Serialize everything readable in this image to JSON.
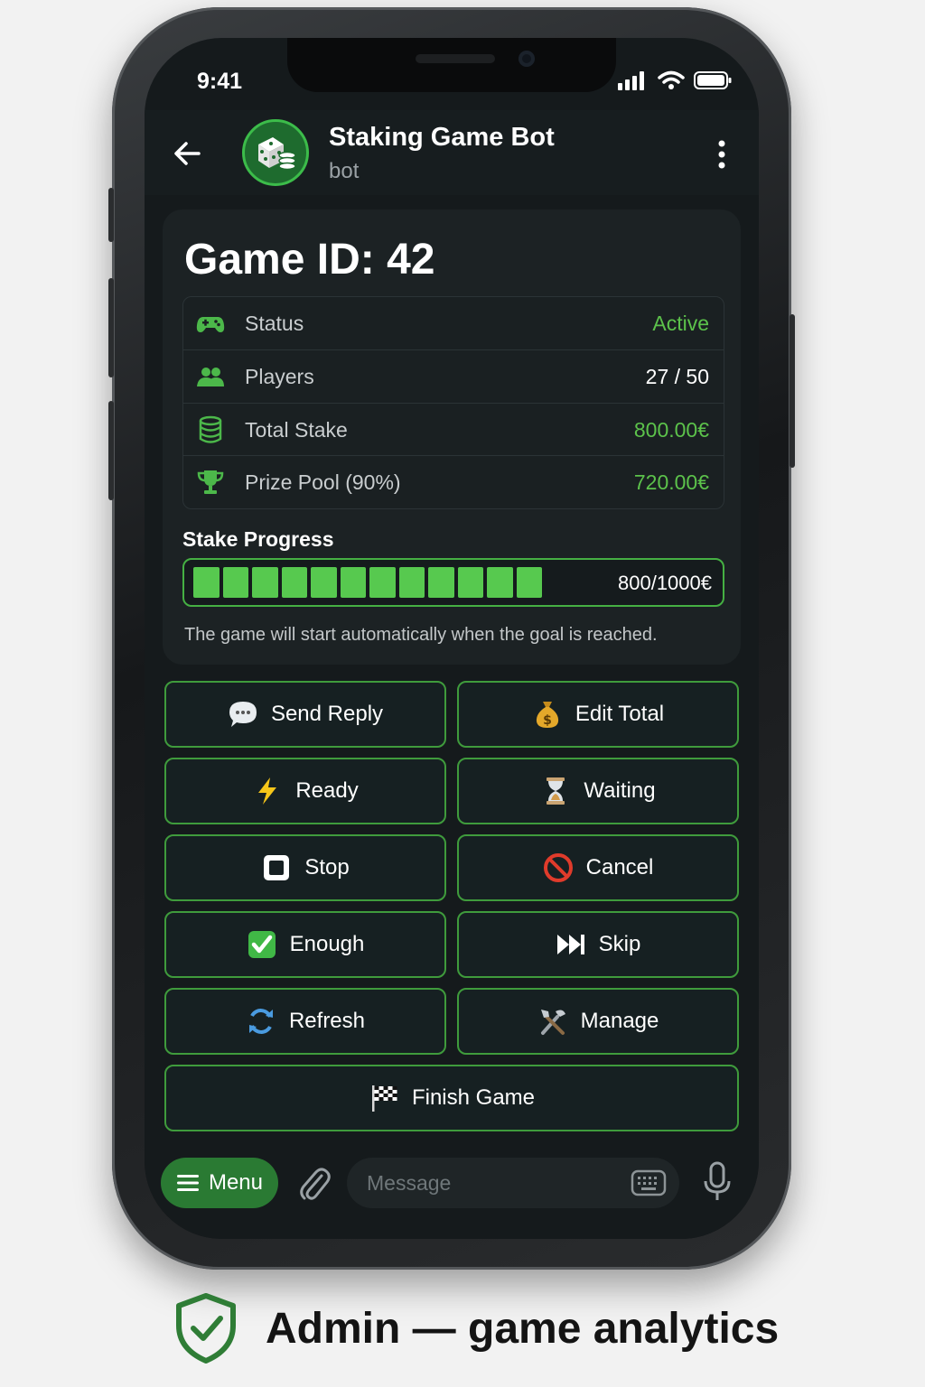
{
  "status_bar": {
    "time": "9:41"
  },
  "chat_header": {
    "title": "Staking Game Bot",
    "subtitle": "bot"
  },
  "game": {
    "title": "Game ID: 42",
    "rows": [
      {
        "label": "Status",
        "value": "Active",
        "value_color": "#5cc24b",
        "icon": "gamepad-icon"
      },
      {
        "label": "Players",
        "value": "27 / 50",
        "value_color": "#ffffff",
        "icon": "users-icon"
      },
      {
        "label": "Total Stake",
        "value": "800.00€",
        "value_color": "#5cc24b",
        "icon": "database-icon"
      },
      {
        "label": "Prize Pool (90%)",
        "value": "720.00€",
        "value_color": "#5cc24b",
        "icon": "trophy-icon"
      }
    ],
    "progress": {
      "label": "Stake Progress",
      "text": "800/1000€",
      "fraction": 0.8,
      "note": "The game will start automatically when the goal is reached."
    }
  },
  "buttons": [
    {
      "label": "Send Reply",
      "icon": "speech-bubble-icon"
    },
    {
      "label": "Edit Total",
      "icon": "money-bag-icon"
    },
    {
      "label": "Ready",
      "icon": "lightning-icon"
    },
    {
      "label": "Waiting",
      "icon": "hourglass-icon"
    },
    {
      "label": "Stop",
      "icon": "stop-square-icon"
    },
    {
      "label": "Cancel",
      "icon": "prohibited-icon"
    },
    {
      "label": "Enough",
      "icon": "check-box-icon"
    },
    {
      "label": "Skip",
      "icon": "skip-forward-icon"
    },
    {
      "label": "Refresh",
      "icon": "refresh-icon"
    },
    {
      "label": "Manage",
      "icon": "tools-icon"
    },
    {
      "label": "Finish Game",
      "icon": "checkered-flag-icon"
    }
  ],
  "composer": {
    "menu_label": "Menu",
    "placeholder": "Message"
  },
  "caption": {
    "text": "Admin — game analytics",
    "icon": "shield-check-icon"
  },
  "colors": {
    "accent_green": "#3f9b3c",
    "value_green": "#5cc24b",
    "menu_green": "#2a7a33"
  }
}
